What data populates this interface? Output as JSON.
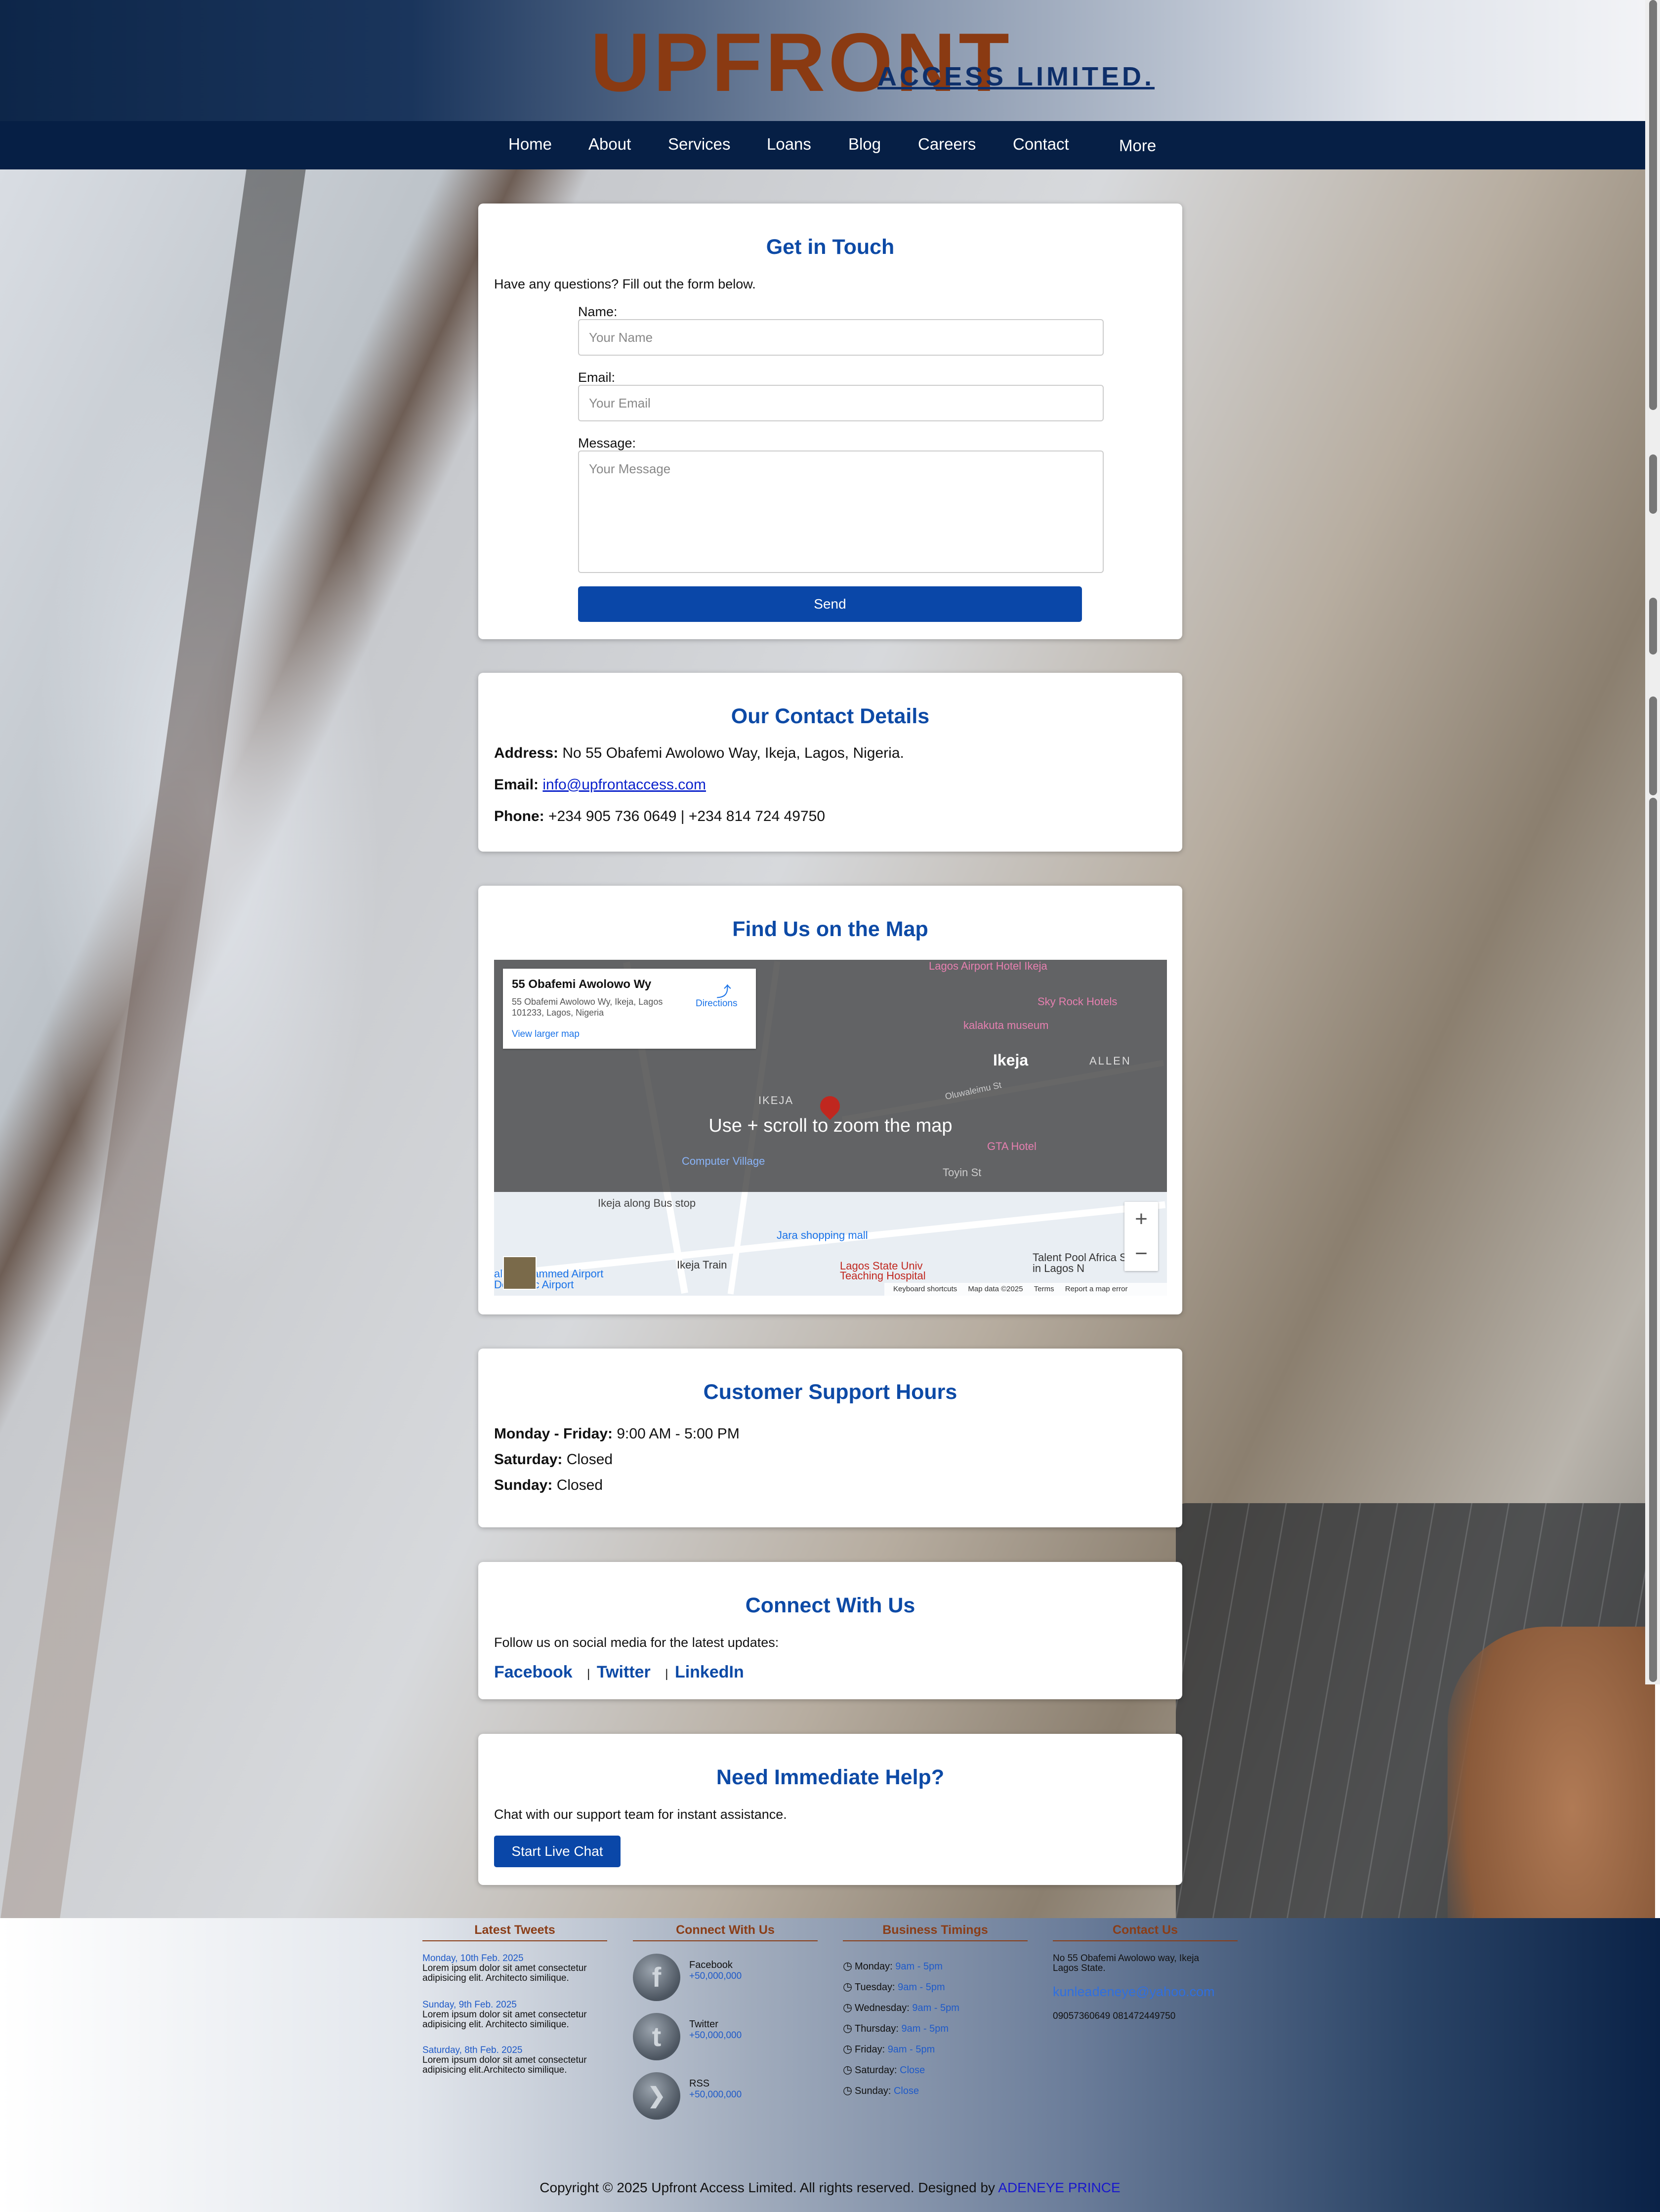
{
  "brand": {
    "name": "UPFRONT",
    "sub": "ACCESS LIMITED."
  },
  "nav": {
    "items": [
      "Home",
      "About",
      "Services",
      "Loans",
      "Blog",
      "Careers",
      "Contact"
    ],
    "more": "More"
  },
  "contact_form": {
    "title": "Get in Touch",
    "intro": "Have any questions? Fill out the form below.",
    "name_label": "Name:",
    "name_placeholder": "Your Name",
    "email_label": "Email:",
    "email_placeholder": "Your Email",
    "message_label": "Message:",
    "message_placeholder": "Your Message",
    "send_label": "Send"
  },
  "contact_details": {
    "title": "Our Contact Details",
    "address_label": "Address:",
    "address": "No 55 Obafemi Awolowo Way, Ikeja, Lagos, Nigeria.",
    "email_label": "Email:",
    "email": "info@upfrontaccess.com",
    "phone_label": "Phone:",
    "phone": "+234 905 736 0649 | +234 814 724 49750"
  },
  "map": {
    "title": "Find Us on the Map",
    "place_name": "55 Obafemi Awolowo Wy",
    "place_address": "55 Obafemi Awolowo Wy, Ikeja, Lagos 101233, Lagos, Nigeria",
    "directions": "Directions",
    "larger_map": "View larger map",
    "overlay_text": "Use    + scroll to zoom the map",
    "labels": {
      "ikeja": "Ikeja",
      "allen": "ALLEN",
      "ikeja_small": "IKEJA",
      "computer_village": "Computer Village",
      "sky_rock": "Sky Rock Hotels",
      "kalakuta": "kalakuta museum",
      "gta": "GTA Hotel",
      "lagos_airport_hotel": "Lagos Airport Hotel Ikeja",
      "bus_stop": "Ikeja along Bus stop",
      "jara": "Jara shopping mall",
      "ikeja_train": "Ikeja Train",
      "lasuth": "Lagos State Univ Teaching Hospital",
      "talent_pool": "Talent Pool Africa School in Lagos N",
      "airport": "ala Muhammed Airport Domestic Airport",
      "toyin": "Toyin St",
      "oluwaleimu": "Oluwaleimu St"
    },
    "footer": [
      "Keyboard shortcuts",
      "Map data ©2025",
      "Terms",
      "Report a map error"
    ]
  },
  "hours": {
    "title": "Customer Support Hours",
    "rows": [
      {
        "label": "Monday - Friday:",
        "value": "9:00 AM - 5:00 PM"
      },
      {
        "label": "Saturday:",
        "value": "Closed"
      },
      {
        "label": "Sunday:",
        "value": "Closed"
      }
    ]
  },
  "connect": {
    "title": "Connect With Us",
    "intro": "Follow us on social media for the latest updates:",
    "links": [
      "Facebook",
      "Twitter",
      "LinkedIn"
    ],
    "separator": "|"
  },
  "help": {
    "title": "Need Immediate Help?",
    "intro": "Chat with our support team for instant assistance.",
    "button": "Start Live Chat"
  },
  "footer": {
    "tweets_title": "Latest Tweets",
    "tweets": [
      {
        "date": "Monday, 10th Feb. 2025",
        "text": "Lorem ipsum dolor sit amet consectetur adipisicing elit. Architecto similique."
      },
      {
        "date": "Sunday, 9th Feb. 2025",
        "text": "Lorem ipsum dolor sit amet consectetur adipisicing elit. Architecto similique."
      },
      {
        "date": "Saturday, 8th Feb. 2025",
        "text": "Lorem ipsum dolor sit amet consectetur adipisicing elit.Architecto similique."
      }
    ],
    "connect_title": "Connect With Us",
    "socials": [
      {
        "name": "Facebook",
        "count": "+50,000,000",
        "icon": "facebook-icon"
      },
      {
        "name": "Twitter",
        "count": "+50,000,000",
        "icon": "twitter-icon"
      },
      {
        "name": "RSS",
        "count": "+50,000,000",
        "icon": "rss-icon"
      }
    ],
    "timings_title": "Business Timings",
    "timings": [
      {
        "day": "Monday:",
        "hours": "9am - 5pm"
      },
      {
        "day": "Tuesday:",
        "hours": "9am - 5pm"
      },
      {
        "day": "Wednesday:",
        "hours": "9am - 5pm"
      },
      {
        "day": "Thursday:",
        "hours": "9am - 5pm"
      },
      {
        "day": "Friday:",
        "hours": "9am - 5pm"
      },
      {
        "day": "Saturday:",
        "hours": "Close"
      },
      {
        "day": "Sunday:",
        "hours": "Close"
      }
    ],
    "contact_title": "Contact Us",
    "contact_address": "No 55 Obafemi Awolowo way, Ikeja Lagos State.",
    "contact_email": "kunleadeneye@yahoo.com",
    "contact_phone": "09057360649 081472449750",
    "copyright": "Copyright © 2025 Upfront Access Limited. All rights reserved. Designed by",
    "designer": "ADENEYE PRINCE"
  }
}
